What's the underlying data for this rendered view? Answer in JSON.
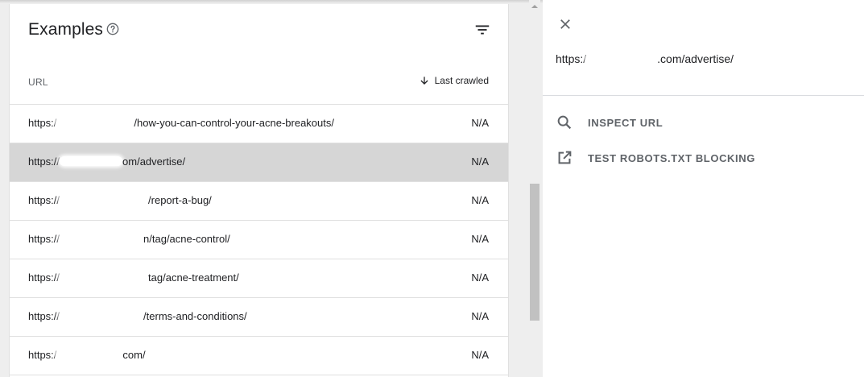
{
  "examples": {
    "title": "Examples",
    "columns": {
      "url": "URL",
      "last_crawled": "Last crawled"
    },
    "rows": [
      {
        "url_prefix": "https:/",
        "url_suffix": "/how-you-can-control-your-acne-breakouts/",
        "last_crawled": "N/A",
        "selected": false
      },
      {
        "url_prefix": "https://",
        "url_suffix": "om/advertise/",
        "last_crawled": "N/A",
        "selected": true
      },
      {
        "url_prefix": "https://",
        "url_suffix": "/report-a-bug/",
        "last_crawled": "N/A",
        "selected": false
      },
      {
        "url_prefix": "https://",
        "url_suffix": "n/tag/acne-control/",
        "last_crawled": "N/A",
        "selected": false
      },
      {
        "url_prefix": "https://",
        "url_suffix": "tag/acne-treatment/",
        "last_crawled": "N/A",
        "selected": false
      },
      {
        "url_prefix": "https://",
        "url_suffix": "/terms-and-conditions/",
        "last_crawled": "N/A",
        "selected": false
      },
      {
        "url_prefix": "https:/",
        "url_suffix": "com/",
        "last_crawled": "N/A",
        "selected": false
      }
    ]
  },
  "detail_panel": {
    "url_prefix": "https:/",
    "url_suffix": ".com/advertise/",
    "actions": [
      {
        "label": "INSPECT URL",
        "icon": "search-icon"
      },
      {
        "label": "TEST ROBOTS.TXT BLOCKING",
        "icon": "open-in-new-icon"
      }
    ]
  },
  "colors": {
    "selected_row": "#d6d6d6",
    "divider": "#e0e0e0",
    "action_text": "#5f6368",
    "scroll_thumb": "#c1c1c1"
  }
}
